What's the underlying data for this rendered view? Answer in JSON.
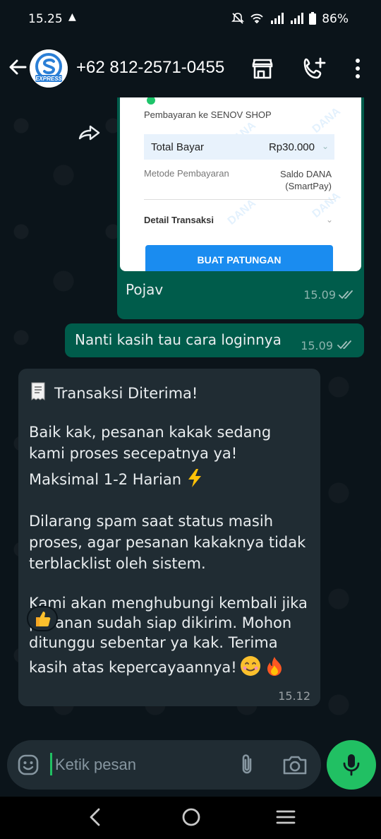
{
  "status_bar": {
    "time": "15.25",
    "battery": "86%"
  },
  "header": {
    "contact_name": "+62 812-2571-0455",
    "avatar_text": "EXPRESS"
  },
  "messages": {
    "image_message": {
      "receipt": {
        "merchant": "Pembayaran ke SENOV SHOP",
        "total_label": "Total Bayar",
        "total_value": "Rp30.000",
        "method_label": "Metode Pembayaran",
        "method_value_line1": "Saldo DANA",
        "method_value_line2": "(SmartPay)",
        "detail_label": "Detail Transaksi",
        "button_label": "BUAT PATUNGAN",
        "watermark": "DANA"
      },
      "caption": "Pojav",
      "time": "15.09"
    },
    "text_message": {
      "text": "Nanti kasih tau cara loginnya",
      "time": "15.09"
    },
    "incoming": {
      "lines": [
        "Transaksi Diterima!",
        "Baik kak, pesanan kakak sedang",
        "kami proses secepatnya ya!",
        "Maksimal 1-2 Harian",
        "Dilarang spam saat status masih",
        "proses, agar pesanan kakaknya tidak",
        "terblacklist oleh sistem.",
        "Kami akan menghubungi kembali jika",
        "pesanan sudah siap dikirim. Mohon",
        "ditunggu sebentar ya kak. Terima",
        "kasih atas kepercayaannya!"
      ],
      "time": "15.12",
      "reaction": "thumbs-up"
    }
  },
  "composer": {
    "placeholder": "Ketik pesan"
  },
  "colors": {
    "background": "#0b141a",
    "outgoing_bubble": "#005c4b",
    "incoming_bubble": "#202c33",
    "accent_green": "#21c063",
    "dana_blue": "#1a8cf0"
  }
}
